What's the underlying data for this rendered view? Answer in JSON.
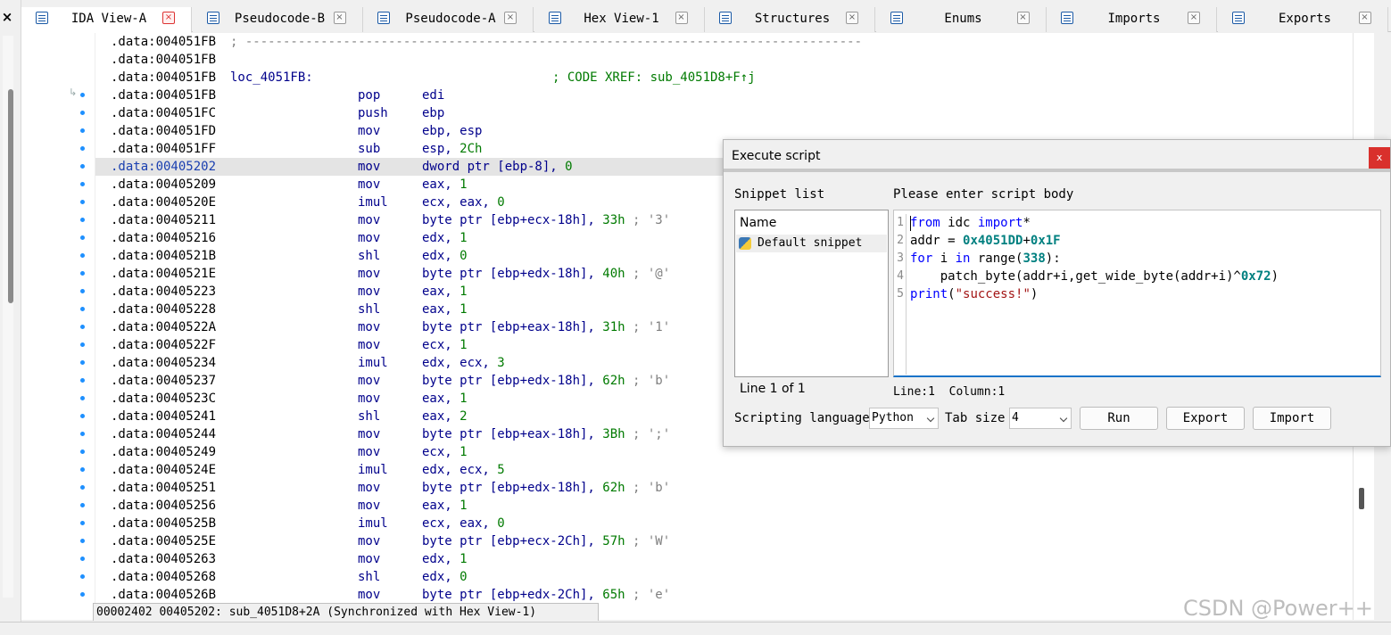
{
  "window": {
    "close_glyph": "×"
  },
  "tabs": [
    {
      "label": "IDA View-A",
      "active": true
    },
    {
      "label": "Pseudocode-B"
    },
    {
      "label": "Pseudocode-A"
    },
    {
      "label": "Hex View-1"
    },
    {
      "label": "Structures"
    },
    {
      "label": "Enums"
    },
    {
      "label": "Imports"
    },
    {
      "label": "Exports"
    }
  ],
  "tab_close_glyph": "×",
  "listing": [
    {
      "addr": ".data:004051FB",
      "comment": "; ----------------------------------------------------------------------------------",
      "type": "sep"
    },
    {
      "addr": ".data:004051FB",
      "type": "blank"
    },
    {
      "addr": ".data:004051FB",
      "label": "loc_4051FB:",
      "xref": "; CODE XREF: sub_4051D8+F↑j",
      "type": "label"
    },
    {
      "addr": ".data:004051FB",
      "mn": "pop",
      "ops": "edi"
    },
    {
      "addr": ".data:004051FC",
      "mn": "push",
      "ops": "ebp"
    },
    {
      "addr": ".data:004051FD",
      "mn": "mov",
      "ops": "ebp, esp"
    },
    {
      "addr": ".data:004051FF",
      "mn": "sub",
      "ops": "esp, ",
      "num": "2Ch"
    },
    {
      "addr": ".data:00405202",
      "mn": "mov",
      "ops": "dword ptr [ebp-8], ",
      "num": "0",
      "hl": true
    },
    {
      "addr": ".data:00405209",
      "mn": "mov",
      "ops": "eax, ",
      "num": "1"
    },
    {
      "addr": ".data:0040520E",
      "mn": "imul",
      "ops": "ecx, eax, ",
      "num": "0"
    },
    {
      "addr": ".data:00405211",
      "mn": "mov",
      "ops": "byte ptr [ebp+ecx-18h], ",
      "num": "33h",
      "cmt": " ; '3'"
    },
    {
      "addr": ".data:00405216",
      "mn": "mov",
      "ops": "edx, ",
      "num": "1"
    },
    {
      "addr": ".data:0040521B",
      "mn": "shl",
      "ops": "edx, ",
      "num": "0"
    },
    {
      "addr": ".data:0040521E",
      "mn": "mov",
      "ops": "byte ptr [ebp+edx-18h], ",
      "num": "40h",
      "cmt": " ; '@'"
    },
    {
      "addr": ".data:00405223",
      "mn": "mov",
      "ops": "eax, ",
      "num": "1"
    },
    {
      "addr": ".data:00405228",
      "mn": "shl",
      "ops": "eax, ",
      "num": "1"
    },
    {
      "addr": ".data:0040522A",
      "mn": "mov",
      "ops": "byte ptr [ebp+eax-18h], ",
      "num": "31h",
      "cmt": " ; '1'"
    },
    {
      "addr": ".data:0040522F",
      "mn": "mov",
      "ops": "ecx, ",
      "num": "1"
    },
    {
      "addr": ".data:00405234",
      "mn": "imul",
      "ops": "edx, ecx, ",
      "num": "3"
    },
    {
      "addr": ".data:00405237",
      "mn": "mov",
      "ops": "byte ptr [ebp+edx-18h], ",
      "num": "62h",
      "cmt": " ; 'b'"
    },
    {
      "addr": ".data:0040523C",
      "mn": "mov",
      "ops": "eax, ",
      "num": "1"
    },
    {
      "addr": ".data:00405241",
      "mn": "shl",
      "ops": "eax, ",
      "num": "2"
    },
    {
      "addr": ".data:00405244",
      "mn": "mov",
      "ops": "byte ptr [ebp+eax-18h], ",
      "num": "3Bh",
      "cmt": " ; ';'"
    },
    {
      "addr": ".data:00405249",
      "mn": "mov",
      "ops": "ecx, ",
      "num": "1"
    },
    {
      "addr": ".data:0040524E",
      "mn": "imul",
      "ops": "edx, ecx, ",
      "num": "5"
    },
    {
      "addr": ".data:00405251",
      "mn": "mov",
      "ops": "byte ptr [ebp+edx-18h], ",
      "num": "62h",
      "cmt": " ; 'b'"
    },
    {
      "addr": ".data:00405256",
      "mn": "mov",
      "ops": "eax, ",
      "num": "1"
    },
    {
      "addr": ".data:0040525B",
      "mn": "imul",
      "ops": "ecx, eax, ",
      "num": "0"
    },
    {
      "addr": ".data:0040525E",
      "mn": "mov",
      "ops": "byte ptr [ebp+ecx-2Ch], ",
      "num": "57h",
      "cmt": " ; 'W'"
    },
    {
      "addr": ".data:00405263",
      "mn": "mov",
      "ops": "edx, ",
      "num": "1"
    },
    {
      "addr": ".data:00405268",
      "mn": "shl",
      "ops": "edx, ",
      "num": "0"
    },
    {
      "addr": ".data:0040526B",
      "mn": "mov",
      "ops": "byte ptr [ebp+edx-2Ch], ",
      "num": "65h",
      "cmt": " ; 'e'"
    }
  ],
  "status_bar": {
    "text": "00002402 00405202: sub_4051D8+2A (Synchronized with Hex View-1)"
  },
  "watermark": "CSDN @Power++",
  "dialog": {
    "title": "Execute script",
    "close_glyph": "x",
    "snippet_list_label": "Snippet list",
    "snippet_header": "Name",
    "snippet_item": "Default snippet",
    "snippet_footer": "Line 1 of 1",
    "body_label": "Please enter script body",
    "line_numbers": [
      "1",
      "2",
      "3",
      "4",
      "5"
    ],
    "code_lines": [
      [
        {
          "t": "from",
          "c": "kw"
        },
        {
          "t": " idc "
        },
        {
          "t": "import",
          "c": "kw"
        },
        {
          "t": "*"
        }
      ],
      [
        {
          "t": "addr = "
        },
        {
          "t": "0x4051DD",
          "c": "hx"
        },
        {
          "t": "+"
        },
        {
          "t": "0x1F",
          "c": "hx"
        }
      ],
      [
        {
          "t": "for",
          "c": "kw"
        },
        {
          "t": " i "
        },
        {
          "t": "in",
          "c": "kw"
        },
        {
          "t": " range("
        },
        {
          "t": "338",
          "c": "hx"
        },
        {
          "t": "):"
        }
      ],
      [
        {
          "t": "    patch_byte(addr+i,get_wide_byte(addr+i)^"
        },
        {
          "t": "0x72",
          "c": "hx"
        },
        {
          "t": ")"
        }
      ],
      [
        {
          "t": "print",
          "c": "kw"
        },
        {
          "t": "("
        },
        {
          "t": "\"success!\"",
          "c": "st"
        },
        {
          "t": ")"
        }
      ]
    ],
    "editor_status": "Line:1  Column:1",
    "lang_label": "Scripting language",
    "lang_value": "Python",
    "tab_label": "Tab size",
    "tab_value": "4",
    "run_label": "Run",
    "export_label": "Export",
    "import_label": "Import"
  },
  "colors": {
    "accent": "#1a73c8",
    "close_red": "#d9302c",
    "gutter_dot": "#1e90ff"
  }
}
